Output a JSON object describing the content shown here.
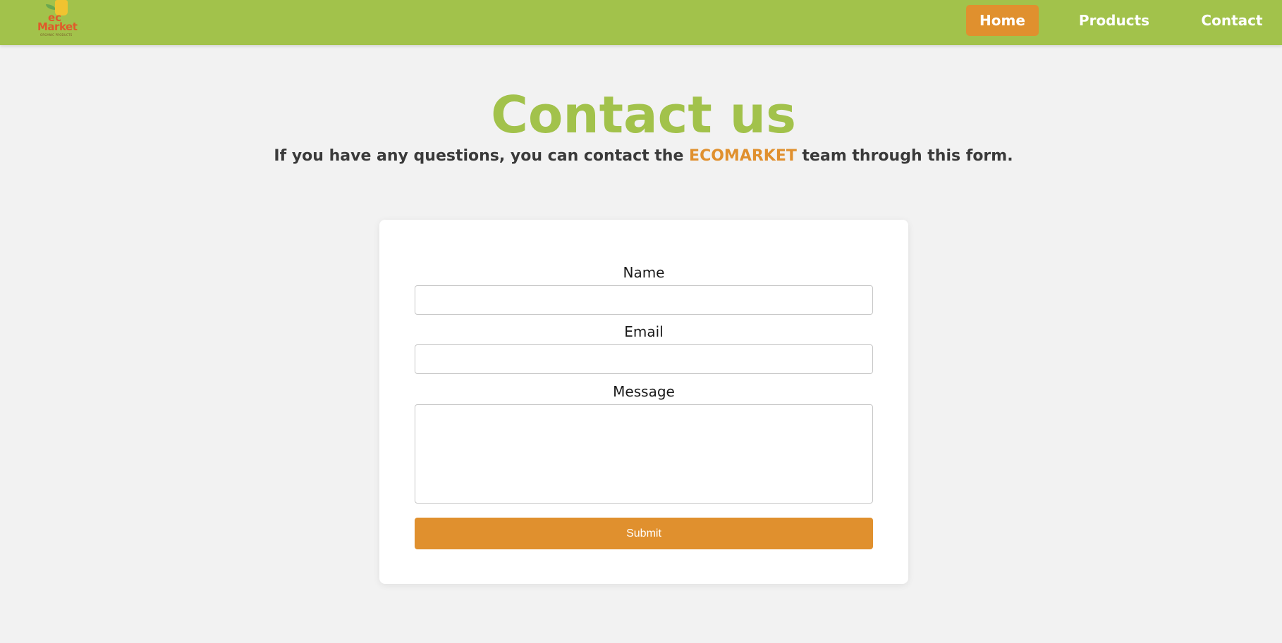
{
  "brand": {
    "logo_line1": "ec",
    "logo_line2": "Market",
    "logo_tagline": "ORGANIC PRODUCTS"
  },
  "nav": {
    "home": "Home",
    "products": "Products",
    "contact": "Contact"
  },
  "page": {
    "title": "Contact us",
    "subtitle_before": "If you have any questions, you can contact the ",
    "subtitle_brand": "ECOMARKET",
    "subtitle_after": " team through this form."
  },
  "form": {
    "name_label": "Name",
    "name_value": "",
    "email_label": "Email",
    "email_value": "",
    "message_label": "Message",
    "message_value": "",
    "submit_label": "Submit"
  },
  "colors": {
    "navbar": "#a2c24b",
    "accent": "#e0902e",
    "background": "#f2f2f2",
    "title": "#a2c24b"
  },
  "icons": {
    "logo": "shopping-bag-icon"
  }
}
